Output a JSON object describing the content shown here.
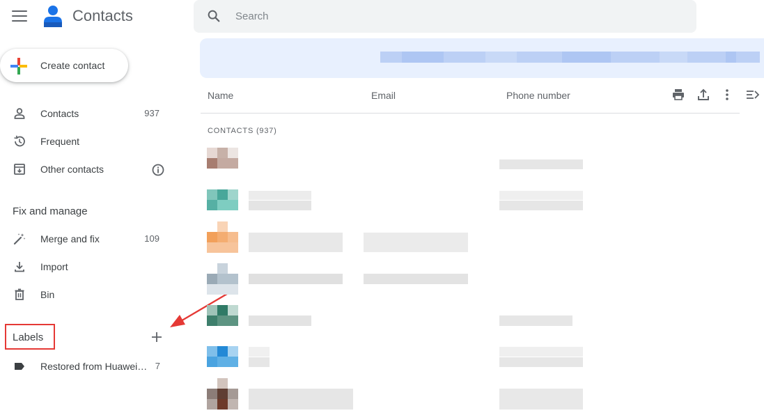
{
  "app": {
    "title": "Contacts",
    "menu_icon": "hamburger-menu-icon",
    "logo_icon": "contacts-person-logo",
    "brand_color": "#1a73e8"
  },
  "search": {
    "placeholder": "Search",
    "value": ""
  },
  "sidebar": {
    "create_label": "Create contact",
    "items": [
      {
        "label": "Contacts",
        "count": "937",
        "icon": "person-icon"
      },
      {
        "label": "Frequent",
        "count": "",
        "icon": "history-icon"
      },
      {
        "label": "Other contacts",
        "count": "",
        "icon": "archive-download-icon",
        "trailing_icon": "info-icon"
      }
    ],
    "fix_section_title": "Fix and manage",
    "fix_items": [
      {
        "label": "Merge and fix",
        "count": "109",
        "icon": "magic-wand-icon"
      },
      {
        "label": "Import",
        "count": "",
        "icon": "download-icon"
      },
      {
        "label": "Bin",
        "count": "",
        "icon": "trash-icon"
      }
    ],
    "labels_title": "Labels",
    "labels": [
      {
        "label": "Restored from Huawei…",
        "count": "7",
        "icon": "label-tag-icon"
      }
    ]
  },
  "table": {
    "columns": [
      "Name",
      "Email",
      "Phone number"
    ],
    "toolbar_icons": [
      "print-icon",
      "export-icon",
      "more-vert-icon",
      "collapse-panel-icon"
    ],
    "section_label": "CONTACTS (937)"
  },
  "annotation": {
    "highlight_color": "#e53935"
  }
}
